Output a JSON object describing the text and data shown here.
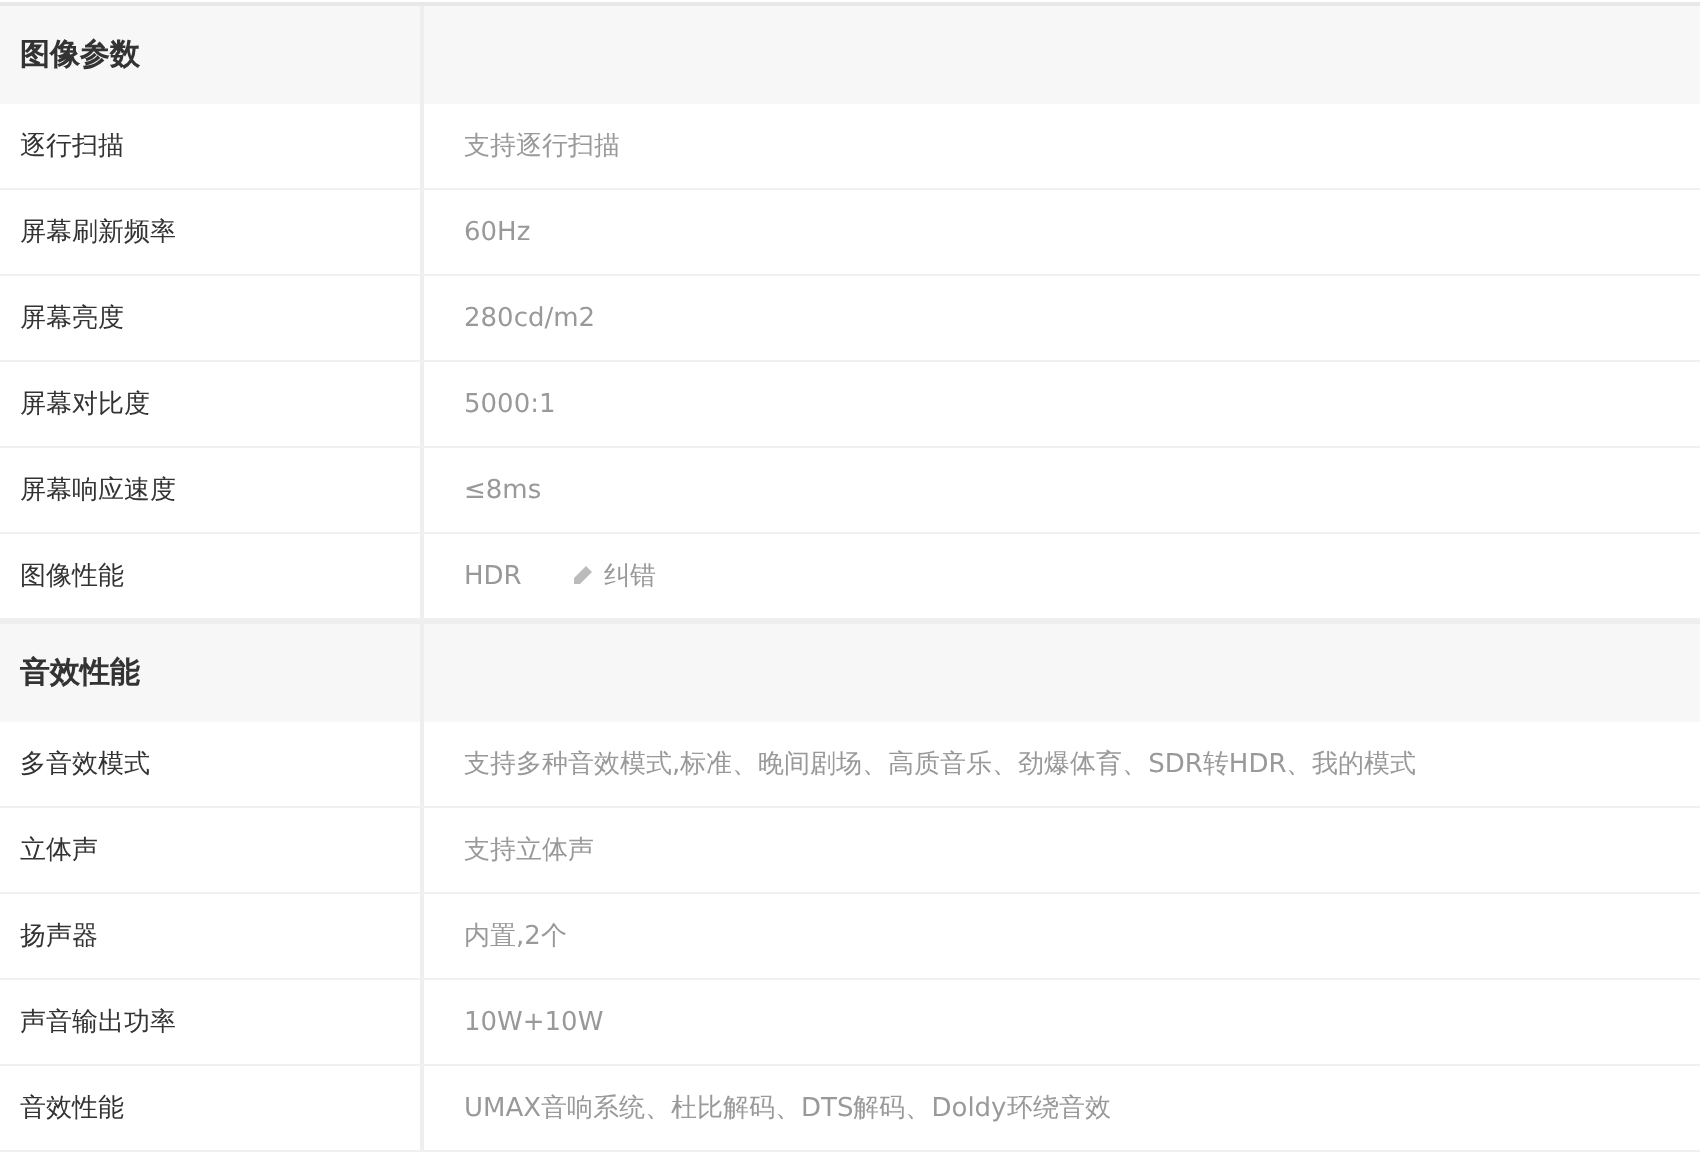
{
  "sections": [
    {
      "title": "图像参数",
      "rows": [
        {
          "label": "逐行扫描",
          "value": "支持逐行扫描"
        },
        {
          "label": "屏幕刷新频率",
          "value": "60Hz"
        },
        {
          "label": "屏幕亮度",
          "value": "280cd/m2"
        },
        {
          "label": "屏幕对比度",
          "value": "5000:1"
        },
        {
          "label": "屏幕响应速度",
          "value": "≤8ms"
        },
        {
          "label": "图像性能",
          "value": "HDR",
          "action": "纠错"
        }
      ]
    },
    {
      "title": "音效性能",
      "rows": [
        {
          "label": "多音效模式",
          "value": "支持多种音效模式,标准、晚间剧场、高质音乐、劲爆体育、SDR转HDR、我的模式"
        },
        {
          "label": "立体声",
          "value": "支持立体声"
        },
        {
          "label": "扬声器",
          "value": "内置,2个"
        },
        {
          "label": "声音输出功率",
          "value": "10W+10W"
        },
        {
          "label": "音效性能",
          "value": "UMAX音响系统、杜比解码、DTS解码、Doldy环绕音效"
        }
      ]
    }
  ]
}
